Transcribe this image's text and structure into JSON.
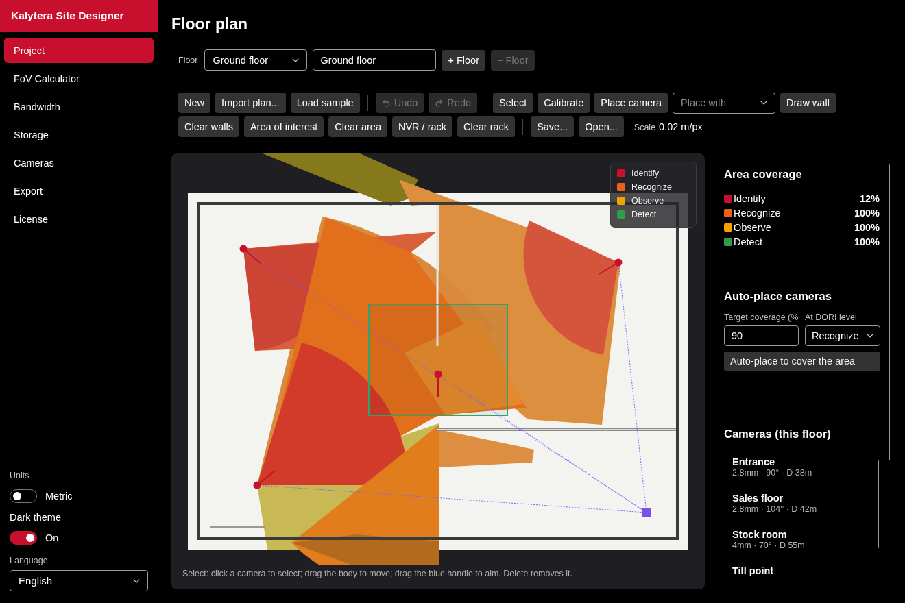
{
  "app": {
    "title": "Kalytera Site Designer"
  },
  "sidebar": {
    "items": [
      {
        "label": "Project",
        "selected": true
      },
      {
        "label": "FoV Calculator",
        "selected": false
      },
      {
        "label": "Bandwidth",
        "selected": false
      },
      {
        "label": "Storage",
        "selected": false
      },
      {
        "label": "Cameras",
        "selected": false
      },
      {
        "label": "Export",
        "selected": false
      },
      {
        "label": "License",
        "selected": false
      }
    ]
  },
  "settings": {
    "units": {
      "label": "Units",
      "on": false,
      "value": "Metric"
    },
    "dark_theme": {
      "label": "Dark theme",
      "on": true,
      "value": "On"
    },
    "language": {
      "label": "Language",
      "value": "English"
    }
  },
  "page": {
    "title": "Floor plan"
  },
  "floor_bar": {
    "label": "Floor",
    "selected_floor": "Ground floor",
    "name_field": "Ground floor",
    "buttons": [
      {
        "label": "+ Floor",
        "disabled": false
      },
      {
        "label": "− Floor",
        "disabled": true
      }
    ]
  },
  "toolbar": {
    "rows": [
      {
        "groups": [
          [
            {
              "kind": "button",
              "label": "New",
              "disabled": false
            },
            {
              "kind": "button",
              "label": "Import plan...",
              "disabled": false
            },
            {
              "kind": "button",
              "label": "Load sample",
              "disabled": false
            }
          ],
          [
            {
              "kind": "undo",
              "label": "Undo",
              "disabled": true
            },
            {
              "kind": "redo",
              "label": "Redo",
              "disabled": true
            }
          ],
          [
            {
              "kind": "button",
              "label": "Select",
              "disabled": false
            },
            {
              "kind": "button",
              "label": "Calibrate",
              "disabled": false
            },
            {
              "kind": "button",
              "label": "Place camera",
              "disabled": false
            },
            {
              "kind": "select",
              "placeholder": "Place with"
            },
            {
              "kind": "button",
              "label": "Draw wall",
              "disabled": false
            }
          ]
        ]
      },
      {
        "groups": [
          [
            {
              "kind": "button",
              "label": "Clear walls",
              "disabled": false
            },
            {
              "kind": "button",
              "label": "Area of interest",
              "disabled": false
            },
            {
              "kind": "button",
              "label": "Clear area",
              "disabled": false
            },
            {
              "kind": "button",
              "label": "NVR / rack",
              "disabled": false
            },
            {
              "kind": "button",
              "label": "Clear rack",
              "disabled": false
            }
          ],
          [
            {
              "kind": "button",
              "label": "Save...",
              "disabled": false
            },
            {
              "kind": "button",
              "label": "Open...",
              "disabled": false
            },
            {
              "kind": "scale",
              "label": "Scale",
              "value": "0.02 m/px"
            }
          ]
        ]
      }
    ]
  },
  "canvas": {
    "legend": [
      {
        "label": "Identify",
        "color": "#c8102e"
      },
      {
        "label": "Recognize",
        "color": "#e8601c"
      },
      {
        "label": "Observe",
        "color": "#f5a200"
      },
      {
        "label": "Detect",
        "color": "#2e9e48"
      }
    ],
    "hint": "Select: click a camera to select; drag the body to move; drag the blue handle to aim. Delete removes it."
  },
  "coverage": {
    "title": "Area coverage",
    "rows": [
      {
        "label": "Identify",
        "value": "12%",
        "color": "#c8102e"
      },
      {
        "label": "Recognize",
        "value": "100%",
        "color": "#e8601c"
      },
      {
        "label": "Observe",
        "value": "100%",
        "color": "#f5a200"
      },
      {
        "label": "Detect",
        "value": "100%",
        "color": "#2e9e48"
      }
    ]
  },
  "auto_place": {
    "title": "Auto-place cameras",
    "target": {
      "label": "Target coverage (%",
      "value": "90"
    },
    "level": {
      "label": "At DORI level",
      "value": "Recognize"
    },
    "button": "Auto-place to cover the area"
  },
  "cameras": {
    "title": "Cameras (this floor)",
    "items": [
      {
        "name": "Entrance",
        "details": "2.8mm · 90° · D 38m"
      },
      {
        "name": "Sales floor",
        "details": "2.8mm · 104° · D 42m"
      },
      {
        "name": "Stock room",
        "details": "4mm · 70° · D 55m"
      },
      {
        "name": "Till point"
      }
    ]
  }
}
